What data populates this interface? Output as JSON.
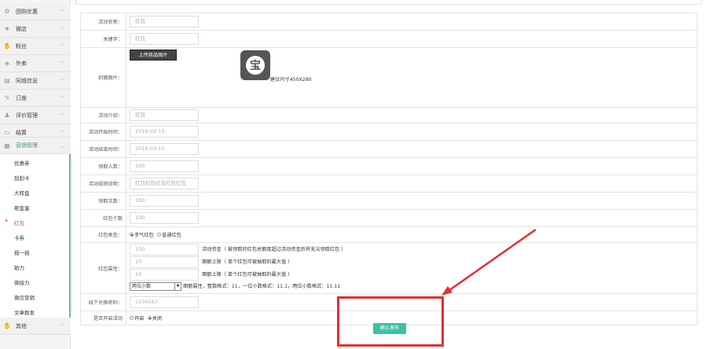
{
  "sidebar": {
    "items": [
      {
        "label": "团购优惠",
        "icon": "group-buy-icon"
      },
      {
        "label": "微店",
        "icon": "star-icon"
      },
      {
        "label": "粉丝",
        "icon": "fan-icon"
      },
      {
        "label": "外卖",
        "icon": "takeout-icon"
      },
      {
        "label": "同城信息",
        "icon": "city-info-icon"
      },
      {
        "label": "订座",
        "icon": "booking-icon"
      },
      {
        "label": "评价管理",
        "icon": "review-icon"
      },
      {
        "label": "结算",
        "icon": "settlement-icon"
      },
      {
        "label": "营销管理",
        "icon": "marketing-icon"
      }
    ],
    "submenu": [
      "优惠券",
      "刮刮卡",
      "大转盘",
      "砸金蛋",
      "红包",
      "卡券",
      "摇一摇",
      "助力",
      "微接力",
      "微信营销",
      "文章群发"
    ],
    "other": {
      "label": "其他",
      "icon": "other-icon"
    }
  },
  "form": {
    "activity_name": {
      "label": "活动名称：",
      "value": "红包"
    },
    "keyword": {
      "label": "关键字：",
      "value": "红包"
    },
    "cover": {
      "label": "封面图片：",
      "upload_button": "上传商品图片",
      "placeholder_glyph": "宝",
      "hint": "建议尺寸450X280"
    },
    "intro": {
      "label": "活动介绍：",
      "value": "红包"
    },
    "start_time": {
      "label": "活动开始时间：",
      "value": "2016-02-15"
    },
    "end_time": {
      "label": "活动结束时间：",
      "value": "2016-03-15"
    },
    "receivers": {
      "label": "领取人数：",
      "value": "100"
    },
    "rules": {
      "label": "活动规则说明：",
      "value": "红包红包红包红包红包"
    },
    "times": {
      "label": "领取次数：",
      "value": "100"
    },
    "count": {
      "label": "红包个数",
      "value": "100"
    },
    "type": {
      "label": "红包类型：",
      "options": [
        "手气红包",
        "普通红包"
      ],
      "selected": "手气红包"
    },
    "attrs": {
      "label": "红包属性：",
      "fund": {
        "value": "100",
        "note": "活动资金（ 被领取的红包总额度超过活动资金后将无法领取红包 ）"
      },
      "max": {
        "value": "10",
        "note": "面额上限（ 单个红包可被抽取的最大值 ）"
      },
      "min": {
        "value": "10",
        "note": "面额上限（ 单个红包可被抽取的最大值 ）"
      },
      "precision": {
        "selected": "两位小数",
        "note": "面额属性，整数格式：11，一位小数格式：11.1，两位小数格式：11.11"
      }
    },
    "offline_password": {
      "label": "线下兑换密码：",
      "value": "1234567"
    },
    "enabled": {
      "label": "是否开启活动",
      "options": [
        "开启",
        "关闭"
      ],
      "selected": "关闭"
    },
    "submit": "确认发布"
  },
  "colors": {
    "accent": "#3fbfa3",
    "annotation": "#e03030",
    "active_item": "#d0505a"
  }
}
